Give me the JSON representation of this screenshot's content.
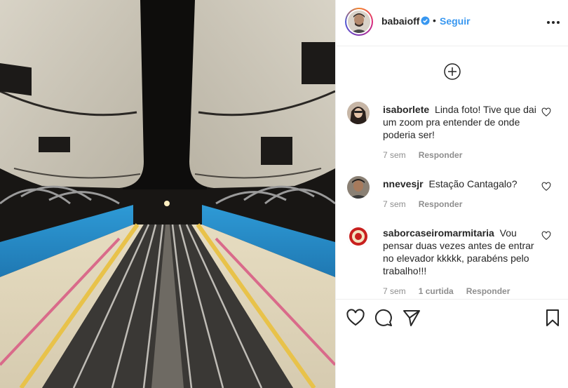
{
  "post": {
    "username": "babaioff",
    "separator": "•",
    "follow_label": "Seguir",
    "verified": true
  },
  "comments": [
    {
      "username": "isaborlete",
      "text": "Linda foto! Tive que dai um zoom pra entender de onde poderia ser!",
      "time": "7 sem",
      "likes": "",
      "reply_label": "Responder"
    },
    {
      "username": "nnevesjr",
      "text": "Estação Cantagalo?",
      "time": "7 sem",
      "likes": "",
      "reply_label": "Responder"
    },
    {
      "username": "saborcaseiromarmitaria",
      "text": "Vou pensar duas vezes antes de entrar no elevador kkkkk, parabéns pelo trabalho!!!",
      "time": "7 sem",
      "likes": "1 curtida",
      "reply_label": "Responder"
    }
  ],
  "icons": {
    "more": "more-options-icon",
    "load_more": "plus-circle-icon",
    "like": "heart-icon",
    "comment": "comment-bubble-icon",
    "share": "paper-plane-icon",
    "save": "bookmark-icon",
    "verified": "verified-badge-icon"
  },
  "colors": {
    "link": "#3897f0",
    "text": "#262626",
    "muted": "#8e8e8e",
    "border": "#efefef"
  }
}
